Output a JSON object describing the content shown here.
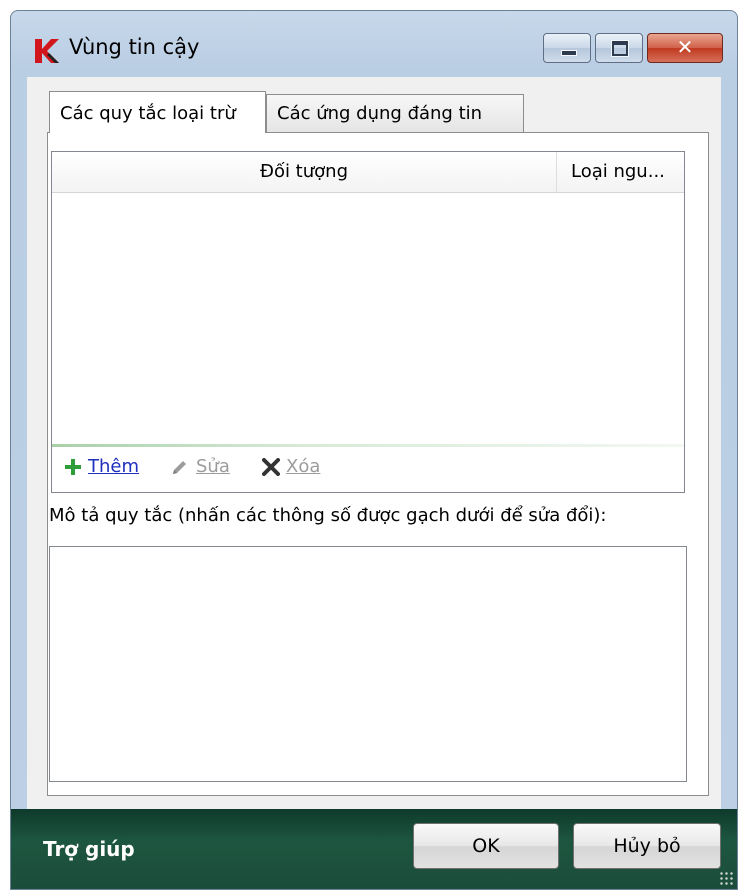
{
  "window": {
    "title": "Vùng tin cậy",
    "controls": {
      "minimize": "minimize",
      "maximize": "maximize",
      "close": "✕"
    }
  },
  "tabs": [
    {
      "label": "Các quy tắc loại trừ",
      "active": true
    },
    {
      "label": "Các ứng dụng đáng tin",
      "active": false
    }
  ],
  "list": {
    "columns": [
      "Đối tượng",
      "Loại ngu..."
    ],
    "rows": []
  },
  "toolbar": {
    "add_label": "Thêm",
    "edit_label": "Sửa",
    "delete_label": "Xóa"
  },
  "description": {
    "label": "Mô tả quy tắc (nhấn các thông số được gạch dưới để sửa đổi):",
    "value": ""
  },
  "footer": {
    "help_label": "Trợ giúp",
    "ok_label": "OK",
    "cancel_label": "Hủy bỏ"
  },
  "colors": {
    "footer_bg": "#1d5640",
    "link_blue": "#1f2fbe",
    "add_icon_green": "#2e9e3a",
    "disabled_gray": "#9c9c9c"
  }
}
